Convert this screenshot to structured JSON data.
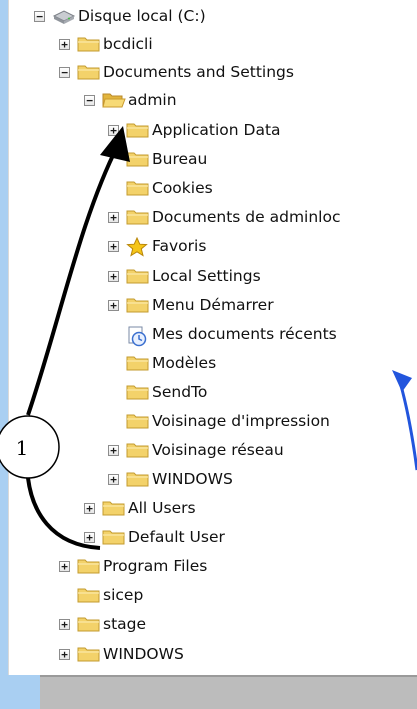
{
  "tree": {
    "items": [
      {
        "label": "Disque local (C:)",
        "icon": "hard-drive-icon",
        "expander": "−",
        "name": "tree-item-disque-local"
      },
      {
        "label": "bcdicli",
        "icon": "folder-icon",
        "expander": "+",
        "name": "tree-item-bcdicli"
      },
      {
        "label": "Documents and Settings",
        "icon": "folder-icon",
        "expander": "−",
        "name": "tree-item-documents-and-settings"
      },
      {
        "label": "admin",
        "icon": "open-folder-icon",
        "expander": "−",
        "name": "tree-item-admin"
      },
      {
        "label": "Application Data",
        "icon": "folder-icon",
        "expander": "+",
        "name": "tree-item-application-data"
      },
      {
        "label": "Bureau",
        "icon": "folder-icon",
        "expander": "",
        "name": "tree-item-bureau"
      },
      {
        "label": "Cookies",
        "icon": "folder-icon",
        "expander": "",
        "name": "tree-item-cookies"
      },
      {
        "label": "Documents de adminloc",
        "icon": "folder-icon",
        "expander": "+",
        "name": "tree-item-documents-de-adminloc"
      },
      {
        "label": "Favoris",
        "icon": "star-icon",
        "expander": "+",
        "name": "tree-item-favoris"
      },
      {
        "label": "Local Settings",
        "icon": "folder-icon",
        "expander": "+",
        "name": "tree-item-local-settings"
      },
      {
        "label": "Menu Démarrer",
        "icon": "folder-icon",
        "expander": "+",
        "name": "tree-item-menu-demarrer"
      },
      {
        "label": "Mes documents récents",
        "icon": "recent-documents-icon",
        "expander": "",
        "name": "tree-item-mes-documents-recents"
      },
      {
        "label": "Modèles",
        "icon": "folder-icon",
        "expander": "",
        "name": "tree-item-modeles"
      },
      {
        "label": "SendTo",
        "icon": "folder-icon",
        "expander": "",
        "name": "tree-item-sendto"
      },
      {
        "label": "Voisinage d'impression",
        "icon": "folder-icon",
        "expander": "",
        "name": "tree-item-voisinage-impression"
      },
      {
        "label": "Voisinage réseau",
        "icon": "folder-icon",
        "expander": "+",
        "name": "tree-item-voisinage-reseau"
      },
      {
        "label": "WINDOWS",
        "icon": "folder-icon",
        "expander": "+",
        "name": "tree-item-windows-admin"
      },
      {
        "label": "All Users",
        "icon": "folder-icon",
        "expander": "+",
        "name": "tree-item-all-users"
      },
      {
        "label": "Default User",
        "icon": "folder-icon",
        "expander": "+",
        "name": "tree-item-default-user"
      },
      {
        "label": "Program Files",
        "icon": "folder-icon",
        "expander": "+",
        "name": "tree-item-program-files"
      },
      {
        "label": "sicep",
        "icon": "folder-icon",
        "expander": "",
        "name": "tree-item-sicep"
      },
      {
        "label": "stage",
        "icon": "folder-icon",
        "expander": "+",
        "name": "tree-item-stage"
      },
      {
        "label": "WINDOWS",
        "icon": "folder-icon",
        "expander": "+",
        "name": "tree-item-windows-root"
      }
    ]
  },
  "annotation": {
    "marker_label": "1",
    "arrow_color": "#000000",
    "blue_arrow_color": "#2255dd"
  },
  "colors": {
    "background": "#a9cff2",
    "folder": "#f3d26a",
    "bottom_bar": "#bcbcbc"
  }
}
